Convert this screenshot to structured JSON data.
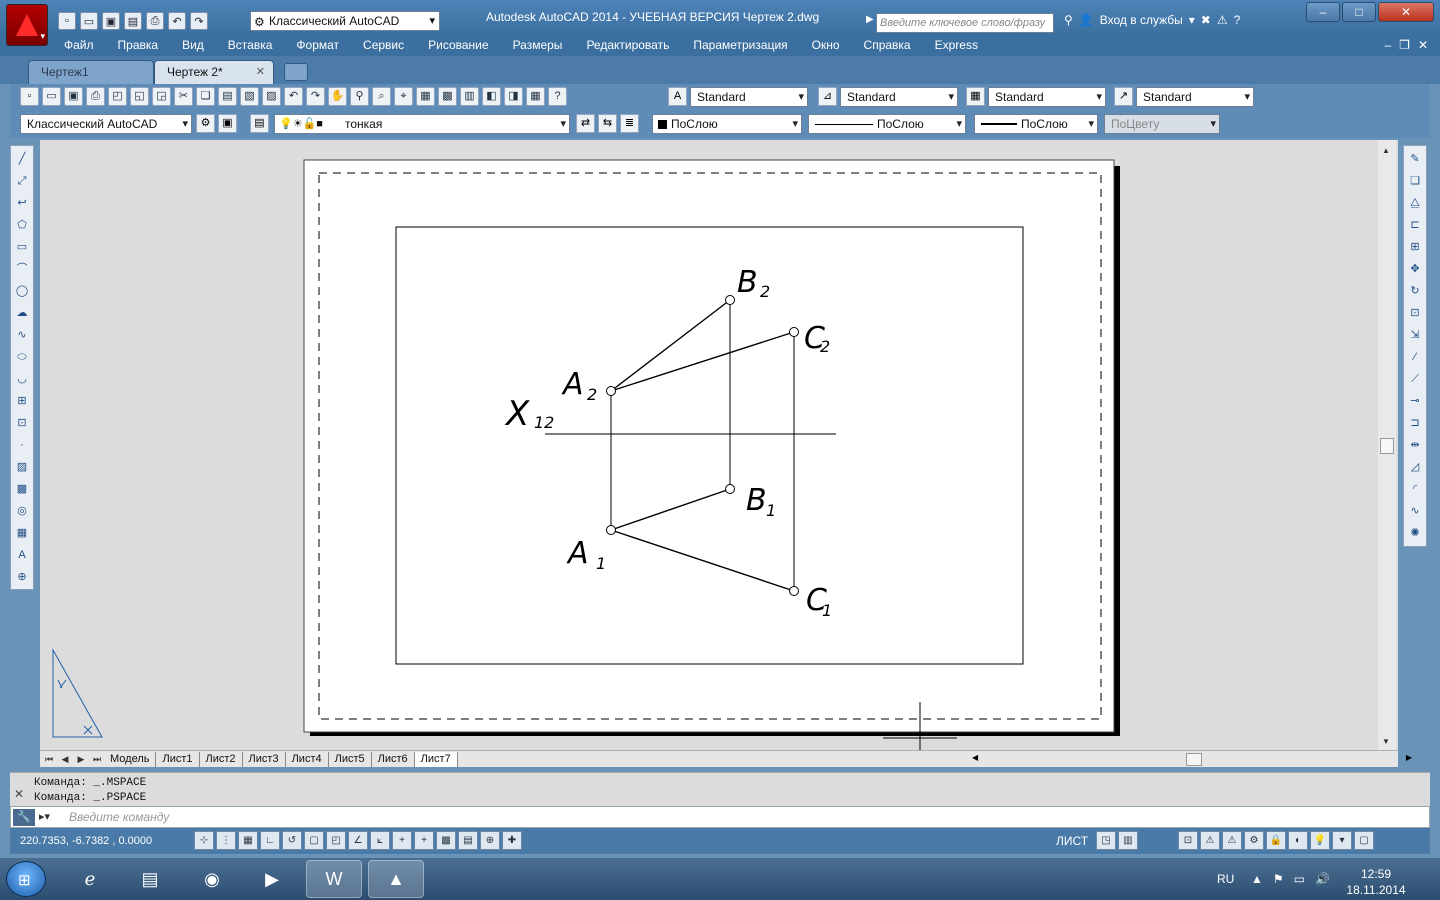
{
  "titlebar": {
    "app_title": "Autodesk AutoCAD 2014 - УЧЕБНАЯ ВЕРСИЯ      Чертеж 2.dwg",
    "workspace": "Классический AutoCAD",
    "search_placeholder": "Введите ключевое слово/фразу",
    "signin": "Вход в службы",
    "qat_icons": [
      "new-icon",
      "open-icon",
      "save-icon",
      "saveas-icon",
      "print-icon",
      "undo-icon",
      "redo-icon"
    ]
  },
  "menubar": {
    "items": [
      "Файл",
      "Правка",
      "Вид",
      "Вставка",
      "Формат",
      "Сервис",
      "Рисование",
      "Размеры",
      "Редактировать",
      "Параметризация",
      "Окно",
      "Справка",
      "Express"
    ]
  },
  "doc_tabs": [
    {
      "label": "Чертеж1"
    },
    {
      "label": "Чертеж 2*"
    }
  ],
  "toolbar_styles": {
    "text_style": "Standard",
    "dim_style": "Standard",
    "table_style": "Standard",
    "mleader_style": "Standard"
  },
  "toolbar_layers": {
    "workspace": "Классический AutoCAD",
    "layer": "тонкая",
    "color": "ПоСлою",
    "linetype": "ПоСлою",
    "lineweight": "ПоСлою",
    "plotstyle": "ПоЦвету"
  },
  "drawing": {
    "axis_label": "X",
    "axis_sub": "12",
    "points": [
      {
        "name": "A",
        "sub": "2"
      },
      {
        "name": "B",
        "sub": "2"
      },
      {
        "name": "C",
        "sub": "2"
      },
      {
        "name": "A",
        "sub": "1"
      },
      {
        "name": "B",
        "sub": "1"
      },
      {
        "name": "C",
        "sub": "1"
      }
    ]
  },
  "layout_tabs": [
    "Модель",
    "Лист1",
    "Лист2",
    "Лист3",
    "Лист4",
    "Лист5",
    "Лист6",
    "Лист7"
  ],
  "command": {
    "history": [
      "Команда:  _.MSPACE",
      "Команда:  _.PSPACE"
    ],
    "placeholder": "Введите команду"
  },
  "status": {
    "coords": "220.7353, -6.7382  , 0.0000",
    "space": "ЛИСТ"
  },
  "taskbar": {
    "lang": "RU",
    "time": "12:59",
    "date": "18.11.2014"
  },
  "colors": {
    "title_blue": "#3b6f9f",
    "autocad_red": "#b30000"
  }
}
